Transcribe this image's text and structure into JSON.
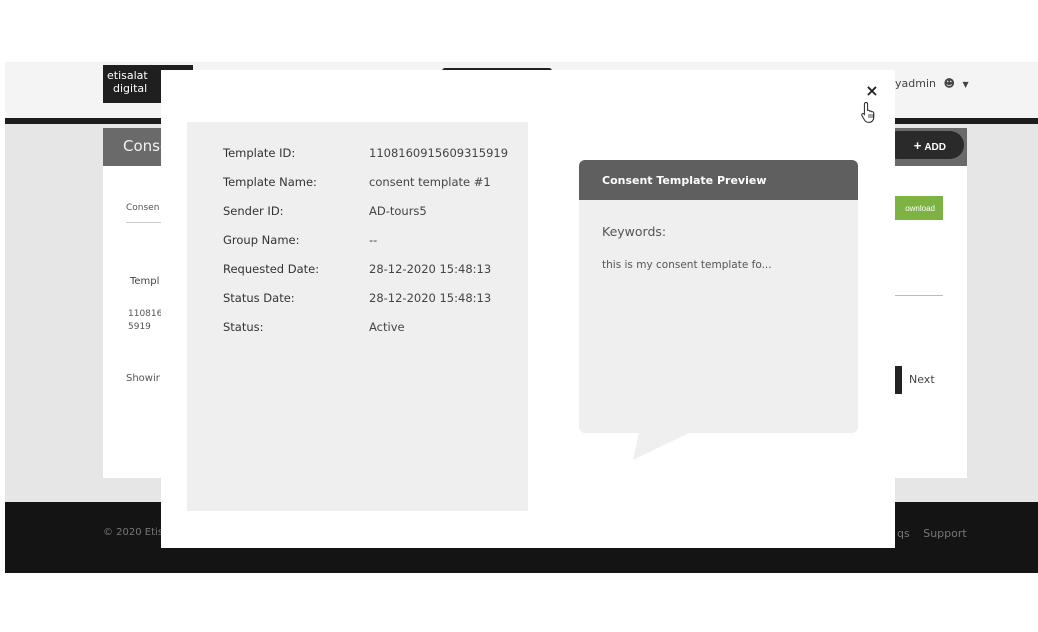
{
  "app": {
    "logo_line1": "etisalat",
    "logo_line2": "digital",
    "user_name": "yadmin",
    "page_title": "Conse",
    "add_label": "ADD",
    "download_label": "ownload",
    "filter_label": "Consen",
    "table_header": "Templ",
    "row_id_line1": "110816",
    "row_id_line2": "5919",
    "showing_label": "Showir",
    "next_label": "Next",
    "copyright": "© 2020 Etis",
    "footer_links": [
      "qs",
      "Support"
    ]
  },
  "modal": {
    "close_label": "×",
    "details": [
      {
        "label": "Template ID:",
        "value": "1108160915609315919"
      },
      {
        "label": "Template Name:",
        "value": "consent template #1"
      },
      {
        "label": "Sender ID:",
        "value": "AD-tours5"
      },
      {
        "label": "Group Name:",
        "value": "--"
      },
      {
        "label": "Requested Date:",
        "value": "28-12-2020 15:48:13"
      },
      {
        "label": "Status Date:",
        "value": "28-12-2020 15:48:13"
      },
      {
        "label": "Status:",
        "value": "Active"
      }
    ],
    "preview": {
      "title": "Consent Template Preview",
      "keywords_label": "Keywords:",
      "text": "this is my consent template fo..."
    }
  },
  "colors": {
    "download_button": "#7cb342",
    "preview_header": "#5f5f5f",
    "footer": "#141414"
  },
  "icons": [
    "user-circle-icon",
    "caret-down-icon",
    "plus-icon",
    "close-icon",
    "hand-pointer-icon"
  ]
}
